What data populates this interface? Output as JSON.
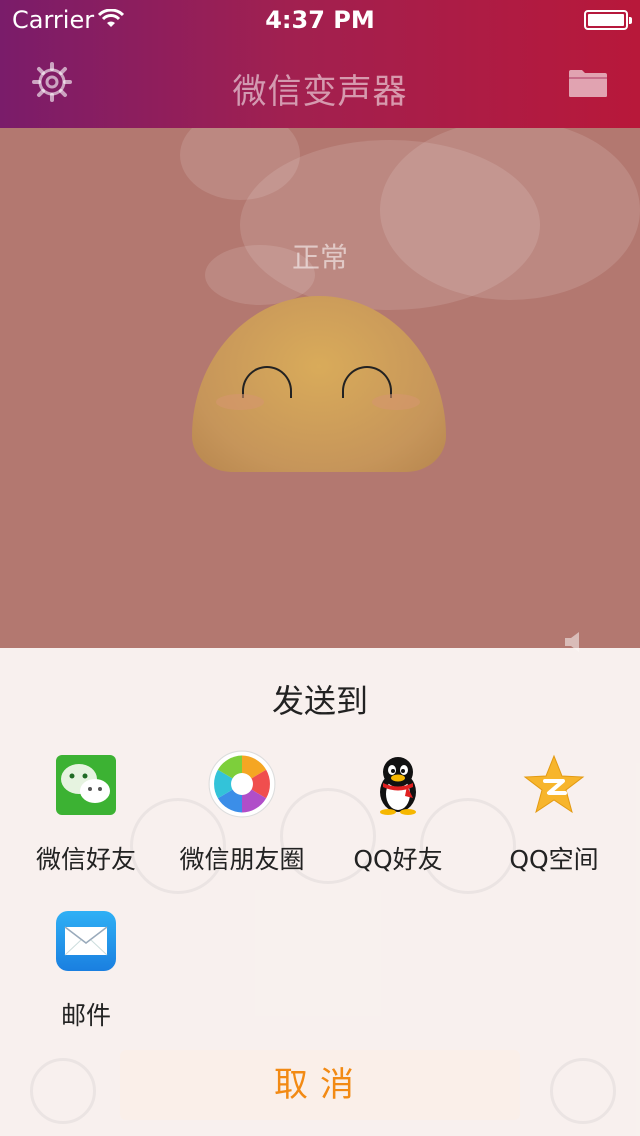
{
  "status_bar": {
    "carrier": "Carrier",
    "time": "4:37 PM"
  },
  "navbar": {
    "title": "微信变声器",
    "left_icon": "gear-icon",
    "right_icon": "folder-icon"
  },
  "main": {
    "mode_label": "正常"
  },
  "share_sheet": {
    "title": "发送到",
    "items": [
      {
        "label": "微信好友",
        "icon": "wechat-icon"
      },
      {
        "label": "微信朋友圈",
        "icon": "wechat-moments-icon"
      },
      {
        "label": "QQ好友",
        "icon": "qq-icon"
      },
      {
        "label": "QQ空间",
        "icon": "qzone-icon"
      },
      {
        "label": "邮件",
        "icon": "mail-icon"
      }
    ],
    "cancel_label": "取消"
  },
  "colors": {
    "accent": "#f28a14",
    "nav_gradient_start": "#7a1c6a",
    "nav_gradient_end": "#b8183a",
    "background": "#b37870"
  }
}
